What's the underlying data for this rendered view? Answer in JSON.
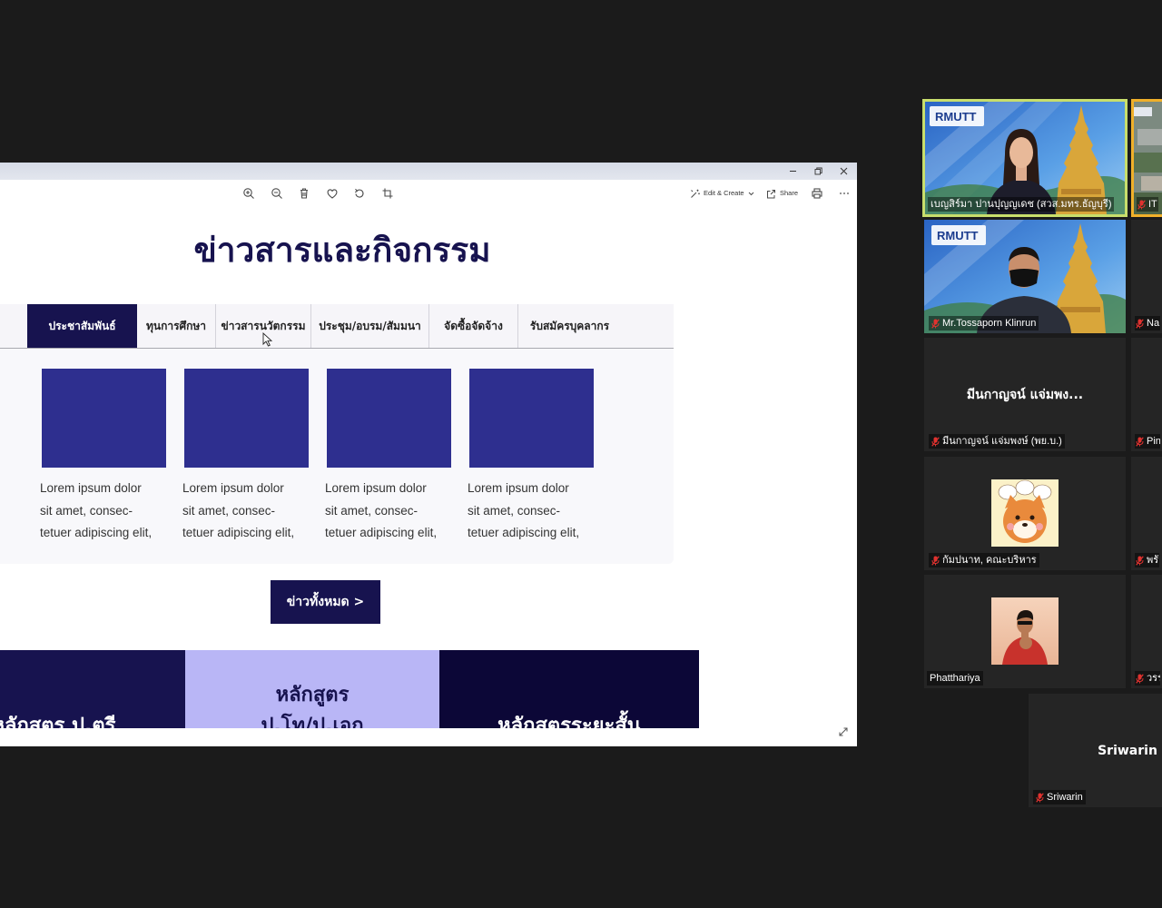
{
  "colors": {
    "page_bg": "#1b1b1b",
    "tile_bg": "#252525",
    "navy": "#17134f",
    "card_blue": "#2e2f8f",
    "lavender": "#b9b6f6",
    "deep_navy": "#0c0737",
    "speaker_border": "#c8de6c",
    "pinned_border": "#f0b02a",
    "muted_red": "#e0322f"
  },
  "viewer": {
    "window_controls": [
      "minimize-icon",
      "restore-icon",
      "close-icon"
    ],
    "toolbar": {
      "left_icons": [
        "zoom-in-icon",
        "zoom-out-icon",
        "delete-icon",
        "favorite-icon",
        "rotate-icon",
        "crop-icon"
      ],
      "edit_create_label": "Edit & Create",
      "share_label": "Share",
      "right_icons": [
        "print-icon",
        "more-icon"
      ]
    }
  },
  "website": {
    "heading": "ข่าวสารและกิจกรรม",
    "tabs": [
      {
        "label": "ประชาสัมพันธ์",
        "active": true
      },
      {
        "label": "ทุนการศึกษา",
        "active": false
      },
      {
        "label": "ข่าวสารนวัตกรรม",
        "active": false
      },
      {
        "label": "ประชุม/อบรม/สัมมนา",
        "active": false
      },
      {
        "label": "จัดซื้อจัดจ้าง",
        "active": false
      },
      {
        "label": "รับสมัครบุคลากร",
        "active": false
      }
    ],
    "cards": [
      {
        "lines": [
          "Lorem ipsum dolor",
          "sit amet, consec-",
          "tetuer adipiscing elit,"
        ]
      },
      {
        "lines": [
          "Lorem ipsum dolor",
          "sit amet, consec-",
          "tetuer adipiscing elit,"
        ]
      },
      {
        "lines": [
          "Lorem ipsum dolor",
          "sit amet, consec-",
          "tetuer adipiscing elit,"
        ]
      },
      {
        "lines": [
          "Lorem ipsum dolor",
          "sit amet, consec-",
          "tetuer adipiscing elit,"
        ]
      }
    ],
    "all_news_button": "ข่าวทั้งหมด >",
    "banners": [
      {
        "lines": [
          "หลักสูตร ป.ตรี"
        ]
      },
      {
        "lines": [
          "หลักสูตร",
          "ป.โท/ป.เอก"
        ]
      },
      {
        "lines": [
          "หลักสูตรระยะสั้น"
        ]
      }
    ]
  },
  "participants": {
    "grid": [
      {
        "name": "เบญสิร์มา ปานปุญญเดช (สวส.มทร.ธัญบุรี)",
        "muted": false,
        "active_speaker": true,
        "logo_text": "RMUTT"
      },
      {
        "name": "Mr.Tossaporn Klinrun",
        "muted": true,
        "logo_text": "RMUTT"
      },
      {
        "name": "มีนกาญจน์ แจ่มพงษ์ (พย.บ.)",
        "muted": true,
        "display_text": "มีนกาญจน์ แจ่มพง..."
      },
      {
        "name": "กัมปนาท, คณะบริหาร",
        "muted": true
      },
      {
        "name": "Phatthariya",
        "muted": false
      },
      {
        "name": "Sriwarin",
        "muted": true,
        "display_text": "Sriwarin"
      }
    ],
    "right_column": [
      {
        "name": "IT",
        "muted": true,
        "pinned": true
      },
      {
        "name": "Na",
        "muted": true
      },
      {
        "name": "Pin",
        "muted": true
      },
      {
        "name": "พรั",
        "muted": true
      },
      {
        "name": "วรร",
        "muted": true
      }
    ]
  }
}
